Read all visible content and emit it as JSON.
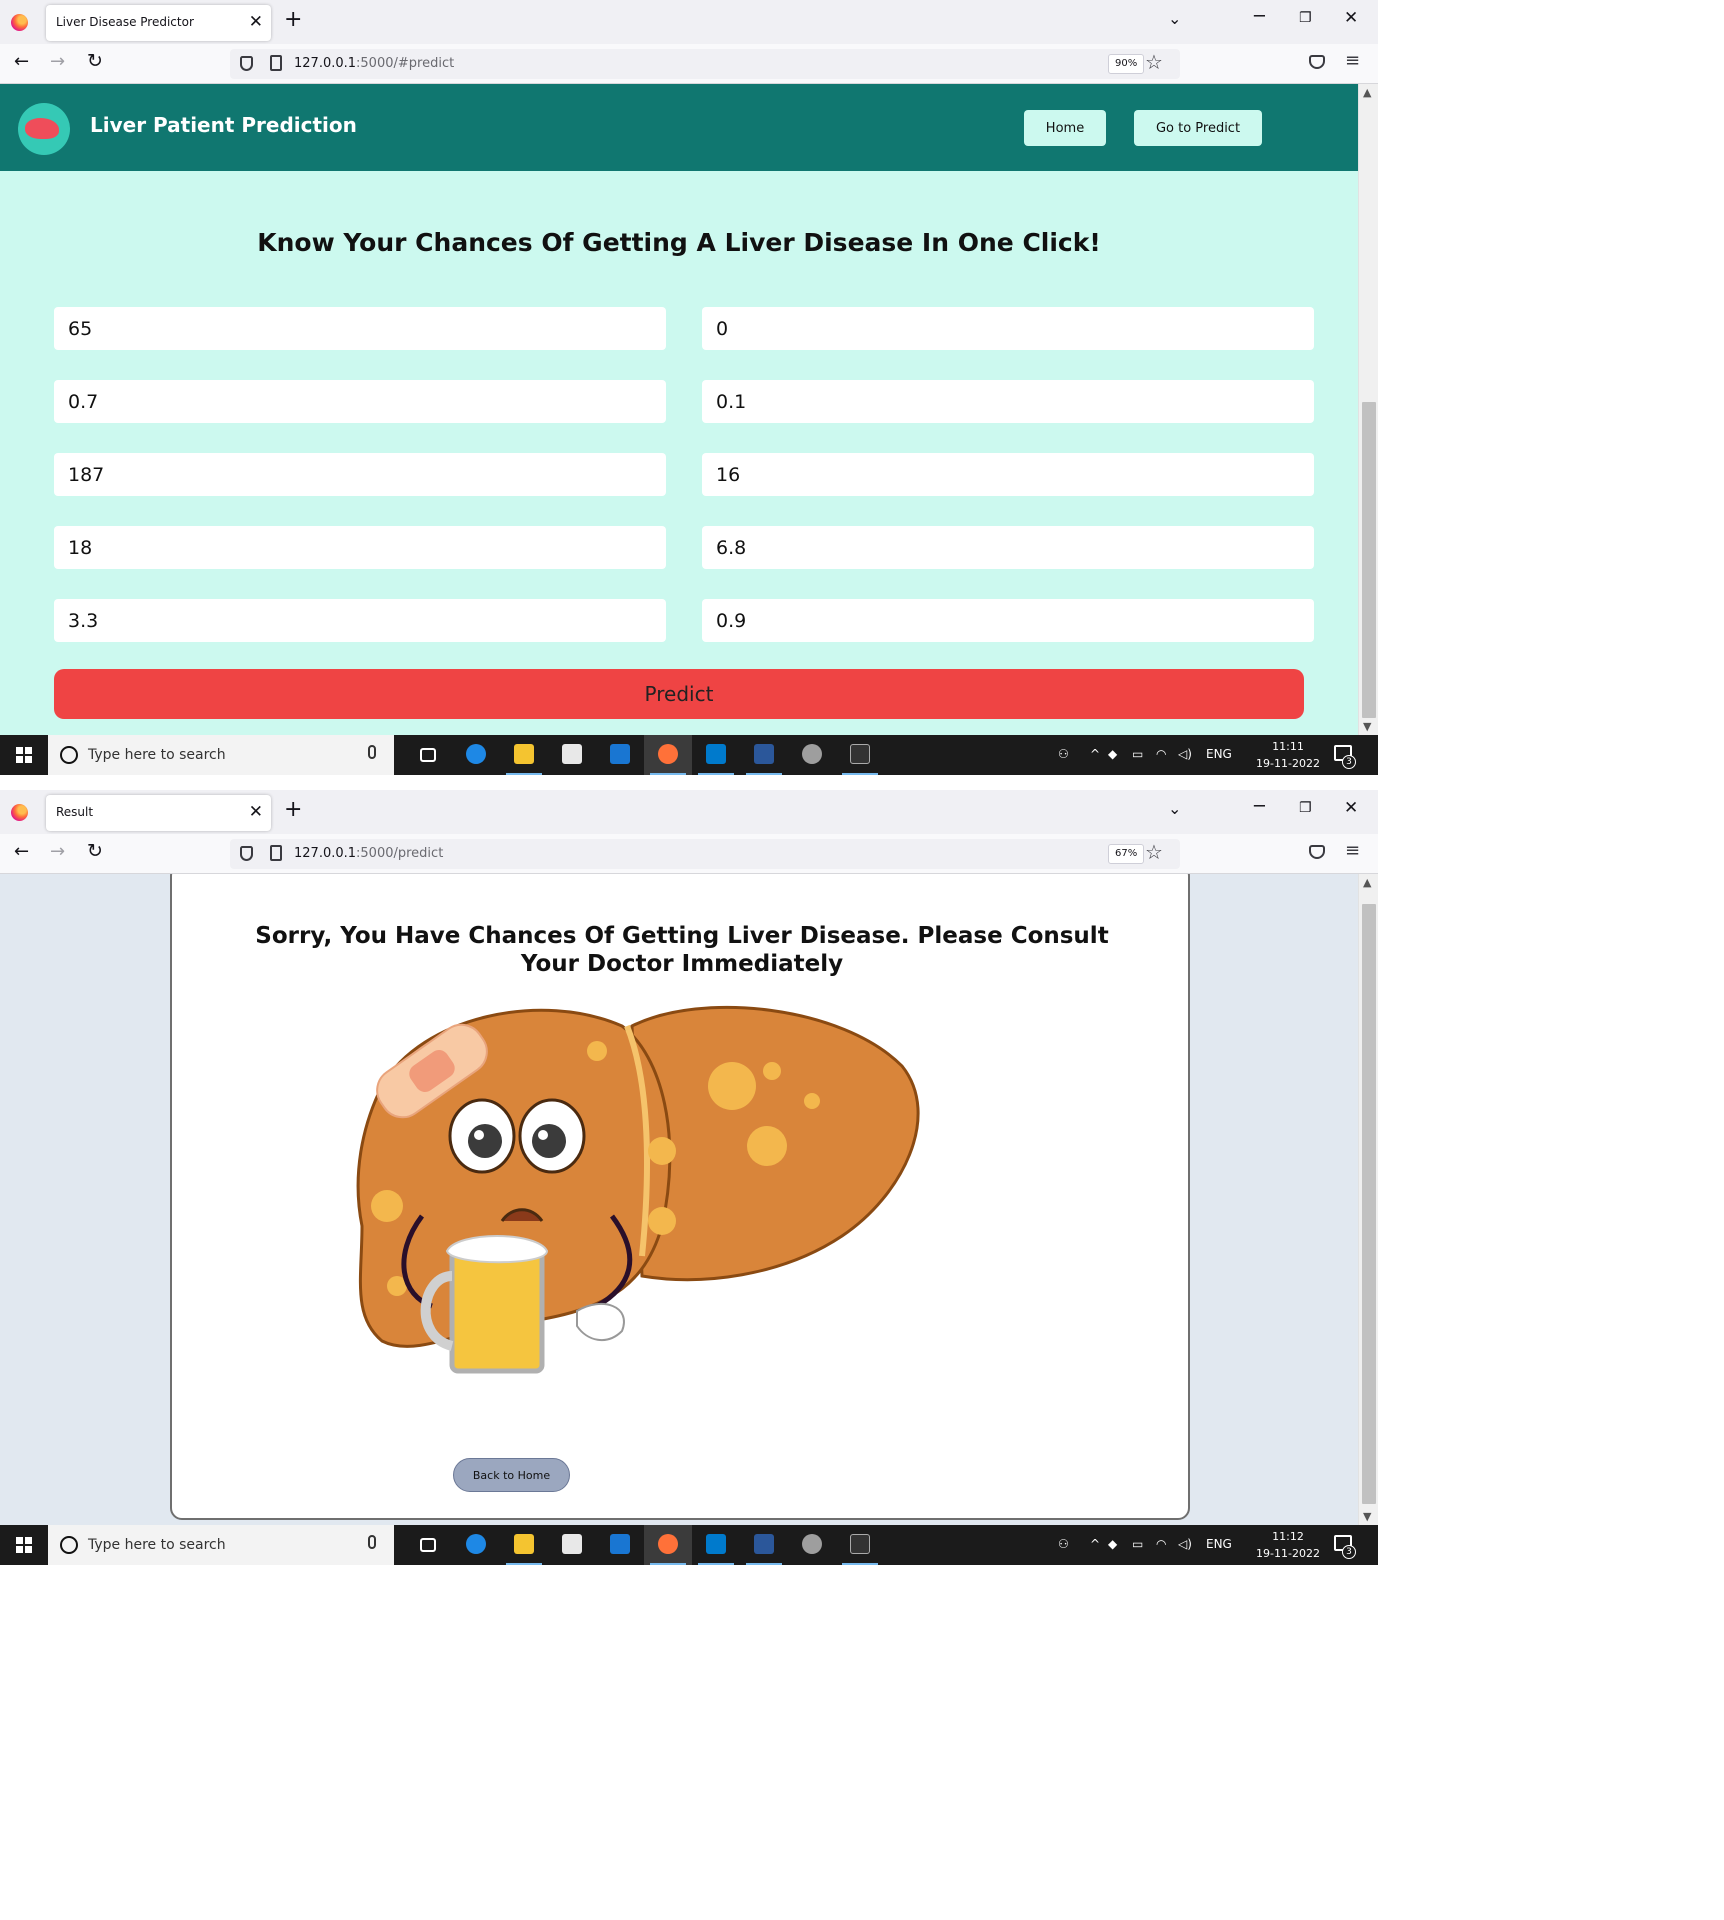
{
  "browser1": {
    "tab_title": "Liver Disease Predictor",
    "url_host": "127.0.0.1",
    "url_path": ":5000/#predict",
    "zoom": "90%"
  },
  "browser2": {
    "tab_title": "Result",
    "url_host": "127.0.0.1",
    "url_path": ":5000/predict",
    "zoom": "67%"
  },
  "header": {
    "title": "Liver Patient Prediction",
    "home_label": "Home",
    "predict_nav_label": "Go to Predict"
  },
  "predict_form": {
    "heading": "Know Your Chances Of Getting A Liver Disease In One Click!",
    "fields": [
      "65",
      "0",
      "0.7",
      "0.1",
      "187",
      "16",
      "18",
      "6.8",
      "3.3",
      "0.9"
    ],
    "submit_label": "Predict"
  },
  "result": {
    "message": "Sorry, You Have Chances Of Getting Liver Disease. Please Consult Your Doctor Immediately",
    "back_label": "Back to Home"
  },
  "taskbar1": {
    "search_placeholder": "Type here to search",
    "lang": "ENG",
    "time": "11:11",
    "date": "19-11-2022",
    "notifications": "3"
  },
  "taskbar2": {
    "search_placeholder": "Type here to search",
    "lang": "ENG",
    "time": "11:12",
    "date": "19-11-2022",
    "notifications": "3"
  },
  "icons": [
    "firefox-logo-icon",
    "close-icon",
    "plus-icon",
    "chevron-down-icon",
    "minimize-icon",
    "restore-icon",
    "back-arrow-icon",
    "forward-arrow-icon",
    "reload-icon",
    "shield-icon",
    "page-icon",
    "star-icon",
    "pocket-icon",
    "hamburger-menu-icon",
    "windows-start-icon",
    "search-icon",
    "microphone-icon",
    "liver-logo-icon"
  ],
  "colors": {
    "header": "#107770",
    "page_bg": "#ccf9ef",
    "predict_button": "#ef4444",
    "result_bg": "#e1e8f0"
  }
}
